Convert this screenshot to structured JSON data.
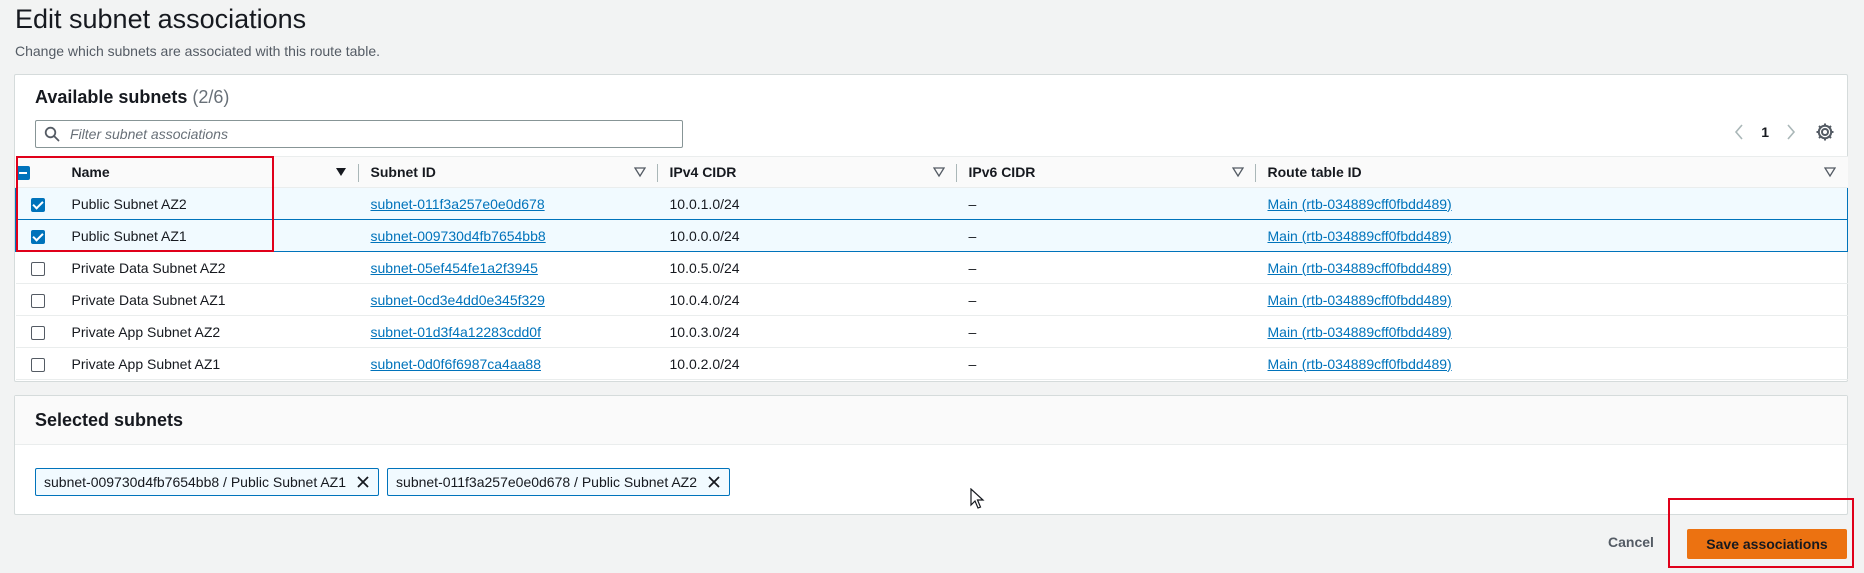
{
  "page": {
    "title": "Edit subnet associations",
    "description": "Change which subnets are associated with this route table."
  },
  "available": {
    "title": "Available subnets",
    "count": "(2/6)",
    "search_placeholder": "Filter subnet associations",
    "page_number": "1",
    "columns": [
      "Name",
      "Subnet ID",
      "IPv4 CIDR",
      "IPv6 CIDR",
      "Route table ID"
    ],
    "rows": [
      {
        "checked": true,
        "name": "Public Subnet AZ2",
        "subnet_id": "subnet-011f3a257e0e0d678",
        "ipv4": "10.0.1.0/24",
        "ipv6": "–",
        "route_table": "Main (rtb-034889cff0fbdd489)"
      },
      {
        "checked": true,
        "name": "Public Subnet AZ1",
        "subnet_id": "subnet-009730d4fb7654bb8",
        "ipv4": "10.0.0.0/24",
        "ipv6": "–",
        "route_table": "Main (rtb-034889cff0fbdd489)"
      },
      {
        "checked": false,
        "name": "Private Data Subnet AZ2",
        "subnet_id": "subnet-05ef454fe1a2f3945",
        "ipv4": "10.0.5.0/24",
        "ipv6": "–",
        "route_table": "Main (rtb-034889cff0fbdd489)"
      },
      {
        "checked": false,
        "name": "Private Data Subnet AZ1",
        "subnet_id": "subnet-0cd3e4dd0e345f329",
        "ipv4": "10.0.4.0/24",
        "ipv6": "–",
        "route_table": "Main (rtb-034889cff0fbdd489)"
      },
      {
        "checked": false,
        "name": "Private App Subnet AZ2",
        "subnet_id": "subnet-01d3f4a12283cdd0f",
        "ipv4": "10.0.3.0/24",
        "ipv6": "–",
        "route_table": "Main (rtb-034889cff0fbdd489)"
      },
      {
        "checked": false,
        "name": "Private App Subnet AZ1",
        "subnet_id": "subnet-0d0f6f6987ca4aa88",
        "ipv4": "10.0.2.0/24",
        "ipv6": "–",
        "route_table": "Main (rtb-034889cff0fbdd489)"
      }
    ]
  },
  "selected": {
    "title": "Selected subnets",
    "tokens": [
      "subnet-009730d4fb7654bb8 / Public Subnet AZ1",
      "subnet-011f3a257e0e0d678 / Public Subnet AZ2"
    ]
  },
  "actions": {
    "cancel_label": "Cancel",
    "save_label": "Save associations"
  },
  "colors": {
    "accent": "#0073bb",
    "primary_button": "#ec7211",
    "highlight_box": "#e0001a"
  }
}
